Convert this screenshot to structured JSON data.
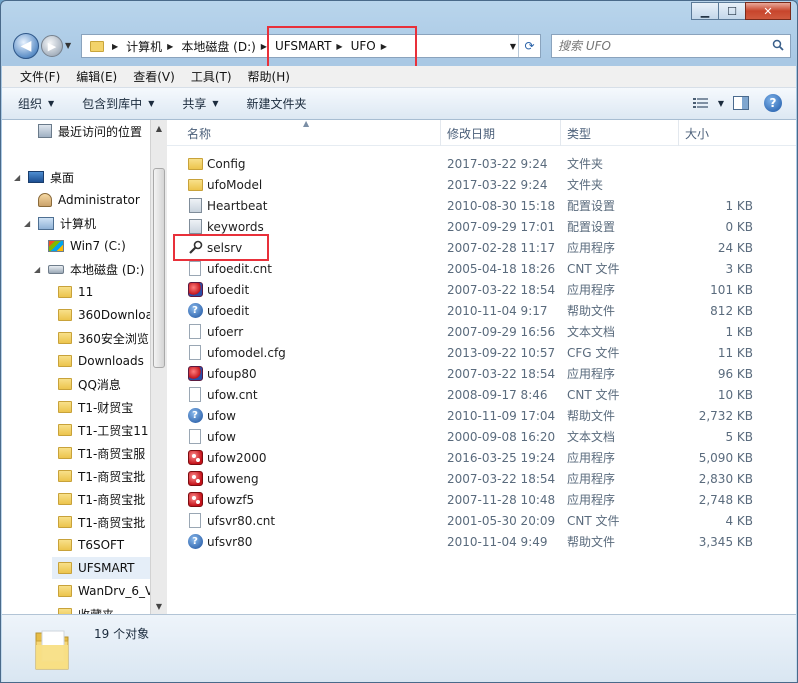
{
  "window": {
    "minimize": "▁",
    "maximize": "☐",
    "close": "✕"
  },
  "address": {
    "crumbs": [
      "计算机",
      "本地磁盘 (D:)",
      "UFSMART",
      "UFO"
    ],
    "search_placeholder": "搜索 UFO"
  },
  "menu": [
    "文件(F)",
    "编辑(E)",
    "查看(V)",
    "工具(T)",
    "帮助(H)"
  ],
  "toolbar": {
    "organize": "组织",
    "include_in_library": "包含到库中",
    "share": "共享",
    "new_folder": "新建文件夹"
  },
  "nav": {
    "items": [
      {
        "label": "最近访问的位置",
        "icon": "recent-places-icon"
      },
      {
        "label": "桌面",
        "icon": "desktop-icon"
      },
      {
        "label": "Administrator",
        "icon": "user-folder-icon"
      },
      {
        "label": "计算机",
        "icon": "computer-icon"
      },
      {
        "label": "Win7 (C:)",
        "icon": "windows-drive-icon"
      },
      {
        "label": "本地磁盘 (D:)",
        "icon": "drive-icon"
      },
      {
        "label": "11",
        "icon": "folder-icon"
      },
      {
        "label": "360Downloa",
        "icon": "folder-icon"
      },
      {
        "label": "360安全浏览",
        "icon": "folder-icon"
      },
      {
        "label": "Downloads",
        "icon": "folder-icon"
      },
      {
        "label": "QQ消息",
        "icon": "folder-icon"
      },
      {
        "label": "T1-财贸宝",
        "icon": "folder-icon"
      },
      {
        "label": "T1-工贸宝11",
        "icon": "folder-icon"
      },
      {
        "label": "T1-商贸宝服",
        "icon": "folder-icon"
      },
      {
        "label": "T1-商贸宝批",
        "icon": "folder-icon"
      },
      {
        "label": "T1-商贸宝批",
        "icon": "folder-icon"
      },
      {
        "label": "T1-商贸宝批",
        "icon": "folder-icon"
      },
      {
        "label": "T6SOFT",
        "icon": "folder-icon"
      },
      {
        "label": "UFSMART",
        "icon": "folder-icon"
      },
      {
        "label": "WanDrv_6_V",
        "icon": "folder-icon"
      },
      {
        "label": "收藏夹",
        "icon": "folder-icon"
      }
    ]
  },
  "columns": {
    "name": "名称",
    "date": "修改日期",
    "type": "类型",
    "size": "大小"
  },
  "files": [
    {
      "name": "Config",
      "date": "2017-03-22 9:24",
      "type": "文件夹",
      "size": "",
      "icon": "folder"
    },
    {
      "name": "ufoModel",
      "date": "2017-03-22 9:24",
      "type": "文件夹",
      "size": "",
      "icon": "folder"
    },
    {
      "name": "Heartbeat",
      "date": "2010-08-30 15:18",
      "type": "配置设置",
      "size": "1 KB",
      "icon": "ini"
    },
    {
      "name": "keywords",
      "date": "2007-09-29 17:01",
      "type": "配置设置",
      "size": "0 KB",
      "icon": "ini"
    },
    {
      "name": "selsrv",
      "date": "2007-02-28 11:17",
      "type": "应用程序",
      "size": "24 KB",
      "icon": "tool"
    },
    {
      "name": "ufoedit.cnt",
      "date": "2005-04-18 18:26",
      "type": "CNT 文件",
      "size": "3 KB",
      "icon": "doc"
    },
    {
      "name": "ufoedit",
      "date": "2007-03-22 18:54",
      "type": "应用程序",
      "size": "101 KB",
      "icon": "app-blue"
    },
    {
      "name": "ufoedit",
      "date": "2010-11-04 9:17",
      "type": "帮助文件",
      "size": "812 KB",
      "icon": "help"
    },
    {
      "name": "ufoerr",
      "date": "2007-09-29 16:56",
      "type": "文本文档",
      "size": "1 KB",
      "icon": "doc"
    },
    {
      "name": "ufomodel.cfg",
      "date": "2013-09-22 10:57",
      "type": "CFG 文件",
      "size": "11 KB",
      "icon": "doc"
    },
    {
      "name": "ufoup80",
      "date": "2007-03-22 18:54",
      "type": "应用程序",
      "size": "96 KB",
      "icon": "app-blue"
    },
    {
      "name": "ufow.cnt",
      "date": "2008-09-17 8:46",
      "type": "CNT 文件",
      "size": "10 KB",
      "icon": "doc"
    },
    {
      "name": "ufow",
      "date": "2010-11-09 17:04",
      "type": "帮助文件",
      "size": "2,732 KB",
      "icon": "help"
    },
    {
      "name": "ufow",
      "date": "2000-09-08 16:20",
      "type": "文本文档",
      "size": "5 KB",
      "icon": "doc"
    },
    {
      "name": "ufow2000",
      "date": "2016-03-25 19:24",
      "type": "应用程序",
      "size": "5,090 KB",
      "icon": "app"
    },
    {
      "name": "ufoweng",
      "date": "2007-03-22 18:54",
      "type": "应用程序",
      "size": "2,830 KB",
      "icon": "app"
    },
    {
      "name": "ufowzf5",
      "date": "2007-11-28 10:48",
      "type": "应用程序",
      "size": "2,748 KB",
      "icon": "app"
    },
    {
      "name": "ufsvr80.cnt",
      "date": "2001-05-30 20:09",
      "type": "CNT 文件",
      "size": "4 KB",
      "icon": "doc"
    },
    {
      "name": "ufsvr80",
      "date": "2010-11-04 9:49",
      "type": "帮助文件",
      "size": "3,345 KB",
      "icon": "help"
    }
  ],
  "status": {
    "count_text": "19 个对象"
  },
  "colors": {
    "highlight": "#e8303a",
    "accent": "#2b63a8"
  }
}
